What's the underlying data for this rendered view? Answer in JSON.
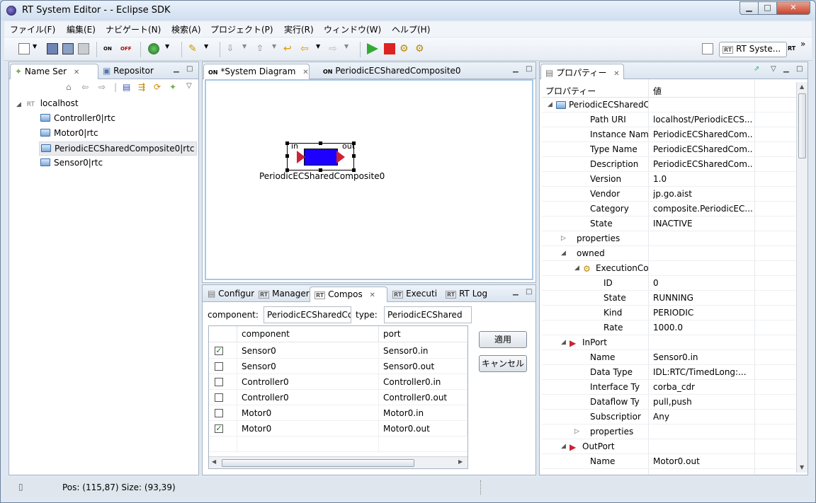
{
  "window": {
    "title": "RT System Editor -  - Eclipse SDK",
    "min": "▁",
    "max": "□",
    "close": "✕"
  },
  "menu": [
    "ファイル(F)",
    "編集(E)",
    "ナビゲート(N)",
    "検索(A)",
    "プロジェクト(P)",
    "実行(R)",
    "ウィンドウ(W)",
    "ヘルプ(H)"
  ],
  "toolbar": {
    "perspective_label": "RT Syste...",
    "more": "»",
    "on_label": "ON",
    "off_label": "OFF"
  },
  "left_panel": {
    "tabs": [
      {
        "label": "Name Ser"
      },
      {
        "label": "Repositor"
      }
    ],
    "tree": {
      "root": "localhost",
      "children": [
        "Controller0|rtc",
        "Motor0|rtc",
        "PeriodicECSharedComposite0|rtc",
        "Sensor0|rtc"
      ]
    }
  },
  "editor": {
    "tabs": [
      {
        "label": "*System Diagram"
      },
      {
        "label": "PeriodicECSharedComposite0"
      }
    ],
    "component": {
      "name": "PeriodicECSharedComposite0",
      "in_label": "in",
      "out_label": "out"
    }
  },
  "bottom_panel": {
    "tabs": [
      {
        "label": "Configur"
      },
      {
        "label": "Manager"
      },
      {
        "label": "Compos"
      },
      {
        "label": "Executi"
      },
      {
        "label": "RT Log"
      }
    ],
    "component_label": "component:",
    "component_value": "PeriodicECSharedCor",
    "type_label": "type:",
    "type_value": "PeriodicECShared",
    "apply_button": "適用",
    "cancel_button": "キャンセル",
    "table": {
      "headers": [
        "component",
        "port"
      ],
      "rows": [
        {
          "checked": "✓",
          "component": "Sensor0",
          "port": "Sensor0.in"
        },
        {
          "checked": "",
          "component": "Sensor0",
          "port": "Sensor0.out"
        },
        {
          "checked": "",
          "component": "Controller0",
          "port": "Controller0.in"
        },
        {
          "checked": "",
          "component": "Controller0",
          "port": "Controller0.out"
        },
        {
          "checked": "",
          "component": "Motor0",
          "port": "Motor0.in"
        },
        {
          "checked": "✓",
          "component": "Motor0",
          "port": "Motor0.out"
        }
      ]
    }
  },
  "properties": {
    "tab": "プロパティー",
    "headers": [
      "プロパティー",
      "値"
    ],
    "rows": [
      {
        "key": "PeriodicECSharedC",
        "value": "",
        "tri": "◢"
      },
      {
        "key": "Path URI",
        "value": "localhost/PeriodicECS...",
        "tri": ""
      },
      {
        "key": "Instance Name",
        "value": "PeriodicECSharedCom...",
        "tri": ""
      },
      {
        "key": "Type Name",
        "value": "PeriodicECSharedCom...",
        "tri": ""
      },
      {
        "key": "Description",
        "value": "PeriodicECSharedCom...",
        "tri": ""
      },
      {
        "key": "Version",
        "value": "1.0",
        "tri": ""
      },
      {
        "key": "Vendor",
        "value": "jp.go.aist",
        "tri": ""
      },
      {
        "key": "Category",
        "value": "composite.PeriodicEC...",
        "tri": ""
      },
      {
        "key": "State",
        "value": "INACTIVE",
        "tri": ""
      },
      {
        "key": "properties",
        "value": "",
        "tri": "▷"
      },
      {
        "key": "owned",
        "value": "",
        "tri": "◢"
      },
      {
        "key": "ExecutionCo",
        "value": "",
        "tri": "◢"
      },
      {
        "key": "ID",
        "value": "0",
        "tri": ""
      },
      {
        "key": "State",
        "value": "RUNNING",
        "tri": ""
      },
      {
        "key": "Kind",
        "value": "PERIODIC",
        "tri": ""
      },
      {
        "key": "Rate",
        "value": "1000.0",
        "tri": ""
      },
      {
        "key": "InPort",
        "value": "",
        "tri": "◢"
      },
      {
        "key": "Name",
        "value": "Sensor0.in",
        "tri": ""
      },
      {
        "key": "Data Type",
        "value": "IDL:RTC/TimedLong:...",
        "tri": ""
      },
      {
        "key": "Interface Ty",
        "value": "corba_cdr",
        "tri": ""
      },
      {
        "key": "Dataflow Ty",
        "value": "pull,push",
        "tri": ""
      },
      {
        "key": "Subscriptior",
        "value": "Any",
        "tri": ""
      },
      {
        "key": "properties",
        "value": "",
        "tri": "▷"
      },
      {
        "key": "OutPort",
        "value": "",
        "tri": "◢"
      },
      {
        "key": "Name",
        "value": "Motor0.out",
        "tri": ""
      }
    ]
  },
  "status": {
    "text": "Pos: (115,87) Size: (93,39)"
  }
}
